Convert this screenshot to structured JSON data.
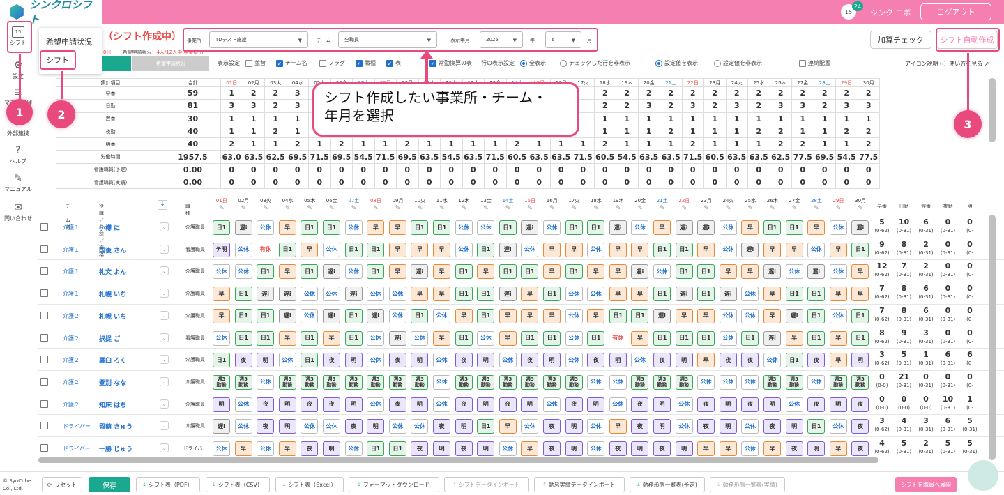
{
  "brand": {
    "logo_text": "シンクロシフト",
    "accent": "#f47fb0",
    "teal": "#1aa88f"
  },
  "header": {
    "badge": "24",
    "cal_num": "15",
    "user": "シンク ロボ",
    "logout": "ログアウト"
  },
  "sidebar": {
    "items": [
      {
        "label": "シフト",
        "icon": "calendar-icon"
      },
      {
        "label": "設定",
        "icon": "gear-icon"
      },
      {
        "label": "マスタ管理",
        "icon": "database-icon"
      },
      {
        "label": "外部連携",
        "icon": "link-icon"
      },
      {
        "label": "ヘルプ",
        "icon": "help-icon"
      },
      {
        "label": "マニュアル",
        "icon": "book-icon"
      },
      {
        "label": "問い合わせ",
        "icon": "mail-icon"
      }
    ]
  },
  "dropdown": {
    "item1": "希望申請状況",
    "item2": "シフト"
  },
  "page": {
    "title": "（シフト作成中）",
    "sub_lead": "0日",
    "sub_label": "希望申請状況：",
    "sub_value": "4人/12人中 希望提出",
    "tab2": "希望申請状況"
  },
  "filters": {
    "office_label": "事業所",
    "office_value": "TDテスト施設",
    "team_label": "チーム",
    "team_value": "全職員",
    "ym_label": "表示年月",
    "year_value": "2025",
    "year_unit": "年",
    "month_value": "6",
    "month_unit": "月"
  },
  "actions": {
    "check": "加算チェック",
    "auto": "シフト自動作成"
  },
  "display": {
    "label": "表示設定",
    "opts": [
      {
        "t": "並替",
        "on": false
      },
      {
        "t": "チーム名",
        "on": true
      },
      {
        "t": "フラグ",
        "on": false
      },
      {
        "t": "職種",
        "on": true
      },
      {
        "t": "表",
        "on": true
      },
      {
        "t": "常勤換算の表",
        "on": true
      }
    ],
    "rowlabel": "行の表示設定",
    "r1": "全表示",
    "r2": "チェックした行を非表示",
    "r3": "設定値を表示",
    "r4": "設定値を非表示",
    "c1": "連続配置",
    "help": "アイコン説明",
    "howto": "使い方を見る"
  },
  "summary": {
    "h_key": "集計項目",
    "h_total": "合計",
    "rows": [
      {
        "k": "早番",
        "t": "59",
        "v": [
          "1",
          "2",
          "2",
          "3",
          "",
          "",
          "",
          "",
          "",
          "",
          "",
          "",
          "",
          "",
          "",
          "",
          "",
          "2",
          "2",
          "2",
          "2",
          "2",
          "2",
          "2",
          "2",
          "2",
          "2",
          "2",
          "2",
          "2"
        ]
      },
      {
        "k": "日勤",
        "t": "81",
        "v": [
          "3",
          "3",
          "2",
          "3",
          "",
          "",
          "",
          "",
          "",
          "",
          "",
          "",
          "",
          "",
          "",
          "",
          "",
          "2",
          "2",
          "3",
          "2",
          "3",
          "2",
          "3",
          "2",
          "3",
          "3",
          "2",
          "3",
          "3"
        ]
      },
      {
        "k": "遅番",
        "t": "30",
        "v": [
          "1",
          "1",
          "1",
          "1",
          "",
          "",
          "",
          "",
          "",
          "",
          "",
          "",
          "",
          "",
          "",
          "",
          "",
          "1",
          "1",
          "1",
          "1",
          "1",
          "1",
          "1",
          "1",
          "1",
          "1",
          "1",
          "1",
          "1"
        ]
      },
      {
        "k": "夜勤",
        "t": "40",
        "v": [
          "1",
          "1",
          "2",
          "1",
          "2",
          "",
          "",
          "",
          "",
          "",
          "",
          "",
          "",
          "",
          "",
          "",
          "",
          "1",
          "1",
          "1",
          "2",
          "1",
          "1",
          "1",
          "2",
          "2",
          "1",
          "1",
          "2",
          "2"
        ]
      },
      {
        "k": "明番",
        "t": "40",
        "v": [
          "2",
          "1",
          "1",
          "2",
          "1",
          "2",
          "1",
          "1",
          "2",
          "1",
          "1",
          "1",
          "1",
          "2",
          "1",
          "1",
          "1",
          "2",
          "1",
          "1",
          "1",
          "2",
          "1",
          "1",
          "1",
          "2",
          "2",
          "1",
          "1",
          "2"
        ]
      },
      {
        "k": "労働時間",
        "t": "1957.5",
        "v": [
          "63.0",
          "63.5",
          "62.5",
          "69.5",
          "71.5",
          "69.5",
          "54.5",
          "71.5",
          "69.5",
          "63.5",
          "54.5",
          "63.5",
          "71.5",
          "60.5",
          "63.5",
          "63.5",
          "71.5",
          "60.5",
          "54.5",
          "63.5",
          "63.5",
          "71.5",
          "60.5",
          "63.5",
          "63.5",
          "62.5",
          "77.5",
          "69.5",
          "54.5",
          "77.5"
        ]
      },
      {
        "k": "看護職員(予定)",
        "t": "0.00",
        "v": [
          "0",
          "0",
          "0",
          "0",
          "0",
          "0",
          "0",
          "0",
          "0",
          "0",
          "0",
          "0",
          "0",
          "0",
          "0",
          "0",
          "0",
          "0",
          "0",
          "0",
          "0",
          "0",
          "0",
          "0",
          "0",
          "0",
          "0",
          "0",
          "0",
          "0"
        ]
      },
      {
        "k": "看護職員(実績)",
        "t": "0.00",
        "v": [
          "0",
          "0",
          "0",
          "0",
          "0",
          "0",
          "0",
          "0",
          "0",
          "0",
          "0",
          "0",
          "0",
          "0",
          "0",
          "0",
          "0",
          "0",
          "0",
          "0",
          "0",
          "0",
          "0",
          "0",
          "0",
          "0",
          "0",
          "0",
          "0",
          "0"
        ]
      }
    ]
  },
  "days": [
    "01日",
    "02月",
    "03火",
    "04水",
    "05木",
    "06金",
    "07土",
    "08日",
    "09月",
    "10火",
    "11水",
    "12木",
    "13金",
    "14土",
    "15日",
    "16月",
    "17火",
    "18水",
    "19木",
    "20金",
    "21土",
    "22日",
    "23月",
    "24火",
    "25水",
    "26木",
    "27金",
    "28土",
    "29日",
    "30月"
  ],
  "grid_header": {
    "team": "チーム名",
    "role": "役職／名前／資格",
    "job": "職種"
  },
  "stats_header": [
    "早番",
    "日勤",
    "遅番",
    "夜勤",
    "明"
  ],
  "staff": [
    {
      "team": "介護１",
      "name": "小樽 に",
      "job": "介護職員",
      "s": "日1,遅i,公休,早,日1,日1,公休,早,早,日1,日1,公休,公休,日1,遅i,公休,日1,日1,遅i,公休,早,遅i,遅i,公休,早,日1,日1,早,公休,遅i",
      "st": [
        [
          "5",
          "(0-62)"
        ],
        [
          "10",
          "(0-31)"
        ],
        [
          "6",
          "(0-31)"
        ],
        [
          "0",
          "(0-31)"
        ],
        [
          "0",
          "(0-"
        ]
      ]
    },
    {
      "team": "介護１",
      "name": "国後 さん",
      "job": "看護職員",
      "s": "テ明,公休,有休,日1,早,公休,日1,日1,早,早,早,公休,日1,遅i,公休,早,早,公休,早,早,日1,日1,早,公休,遅i,早,早,公休,早,日1",
      "st": [
        [
          "9",
          "(0-62)"
        ],
        [
          "8",
          "(0-31)"
        ],
        [
          "2",
          "(0-31)"
        ],
        [
          "0",
          "(0-31)"
        ],
        [
          "0",
          "(0-"
        ]
      ]
    },
    {
      "team": "介護１",
      "name": "礼文 よん",
      "job": "介護職員",
      "s": "公休,公休,日1,早,日1,遅i,公休,日1,早,遅i,早,日1,早,日1,日1,早,日1,早,早,遅i,公休,日1,日1,早,早,遅i,公休,遅i,公休,早",
      "st": [
        [
          "12",
          "(0-62)"
        ],
        [
          "7",
          "(0-31)"
        ],
        [
          "2",
          "(0-31)"
        ],
        [
          "0",
          "(0-31)"
        ],
        [
          "0",
          "(0-"
        ]
      ]
    },
    {
      "team": "介護１",
      "name": "札幌 いち",
      "job": "介護職員",
      "s": "早,日1,遅i,遅i,公休,公休,遅i,公休,公休,早,早,日1,日1,遅i,早,日1,公休,公休,早,早,日1,遅i,日1,遅i,公休,早,日1,日1,早,早",
      "st": [
        [
          "7",
          "(0-62)"
        ],
        [
          "8",
          "(0-31)"
        ],
        [
          "6",
          "(0-31)"
        ],
        [
          "0",
          "(0-31)"
        ],
        [
          "0",
          "(0-"
        ]
      ]
    },
    {
      "team": "介護２",
      "name": "札幌 いち",
      "job": "介護職員",
      "s": "早,日1,日1,遅i,公休,遅i,日1,遅i,公休,日1,公休,早,日1,早,早,早,公休,早,日1,日1,遅i,早,早,公休,公休,早,遅i,日1,公休,日1",
      "st": [
        [
          "7",
          "(0-62)"
        ],
        [
          "8",
          "(0-31)"
        ],
        [
          "6",
          "(0-31)"
        ],
        [
          "0",
          "(0-31)"
        ],
        [
          "0",
          "(0-"
        ]
      ]
    },
    {
      "team": "介護２",
      "name": "択捉 ご",
      "job": "看護職員",
      "s": "公休,日1,日1,早,日1,早,日1,公休,遅i,公休,早,日1,公休,早,日1,日1,公休,日1,有休,早,日1,日1,日1,公休,日1,遅i,早,日1,早,日1",
      "st": [
        [
          "8",
          "(0-62)"
        ],
        [
          "9",
          "(0-31)"
        ],
        [
          "3",
          "(0-31)"
        ],
        [
          "0",
          "(0-31)"
        ],
        [
          "0",
          "(0-"
        ]
      ]
    },
    {
      "team": "介護２",
      "name": "羅臼 ろく",
      "job": "介護職員",
      "s": "日1,夜,明,公休,日1,夜,明,公休,夜,明,公休,夜,明,公休,夜,明,公休,夜,明,公休,夜,明,早,夜,夜,公休,日1,夜,早,明",
      "st": [
        [
          "3",
          "(0-62)"
        ],
        [
          "5",
          "(0-31)"
        ],
        [
          "1",
          "(0-31)"
        ],
        [
          "6",
          "(0-31)"
        ],
        [
          "6",
          "(0-"
        ]
      ]
    },
    {
      "team": "介護２",
      "name": "登別 なな",
      "job": "介護職員",
      "s": "週3,週3,公休,週3,週3,週3,週3,週3,週3,週3,公休,週3,週3,週3,週3,週3,週3,公休,公休,週3,週3,週3,公休,公休,公休,週3,週3,公休,週3,週3",
      "st": [
        [
          "0",
          "(0-0)"
        ],
        [
          "21",
          "(0-31)"
        ],
        [
          "0",
          "(0-31)"
        ],
        [
          "0",
          "(0-31)"
        ],
        [
          "0",
          "(0-"
        ]
      ]
    },
    {
      "team": "介護２",
      "name": "知床 はち",
      "job": "介護職員",
      "s": "明,公休,夜,明,夜,夜,明,公休,夜,明,公休,夜,明,夜,明,公休,夜,明,公休,夜,明,公休,夜,明,夜,明,公休,夜,明,夜",
      "st": [
        [
          "0",
          "(0-0)"
        ],
        [
          "0",
          "(0-0)"
        ],
        [
          "0",
          "(0-0)"
        ],
        [
          "10",
          "(0-31)"
        ],
        [
          "1",
          "(0-"
        ]
      ]
    },
    {
      "team": "ドライバー",
      "name": "留萌 きゅう",
      "job": "介護職員",
      "s": "遅i,公休,夜,明,公休,公休,夜,明,公休,公休,夜,明,日1,早,公休,夜,明,公休,早,夜,明,公休,夜,明,公休,夜,明,日1,公休,夜",
      "st": [
        [
          "3",
          "(0-62)"
        ],
        [
          "4",
          "(0-31)"
        ],
        [
          "3",
          "(0-31)"
        ],
        [
          "6",
          "(0-31)"
        ],
        [
          "5",
          "(0-31)"
        ]
      ]
    },
    {
      "team": "ドライバー",
      "name": "十勝 じゅう",
      "job": "ドライバー",
      "s": "公休,早,公休,早,夜,明,公休,日1,日1,夜,明,夜,明,公休,早,夜,明,公休,夜,明,夜,明,早,早,公休,早,夜,明,早,夜",
      "st": [
        [
          "4",
          "(0-62)"
        ],
        [
          "5",
          "(0-31)"
        ],
        [
          "2",
          "(0-31)"
        ],
        [
          "5",
          "(0-31)"
        ],
        [
          "5",
          "(0-31)"
        ]
      ]
    }
  ],
  "footer": {
    "copy1": "© SynCube",
    "copy2": "Co., Ltd.",
    "reset": "リセット",
    "save": "保存",
    "pdf": "シフト表（PDF）",
    "csv": "シフト表（CSV）",
    "excel": "シフト表（Excel）",
    "fmt": "フォーマットダウンロード",
    "imp": "シフトデータインポート",
    "att": "勤怠実績データインポート",
    "list1": "勤務形態一覧表(予定)",
    "list2": "勤務形態一覧表(実績)",
    "expand": "シフトを職員へ展開"
  },
  "callout": {
    "line1": "シフト作成したい事業所・チーム・",
    "line2": "年月を選択"
  },
  "markers": [
    "1",
    "2",
    "3"
  ]
}
